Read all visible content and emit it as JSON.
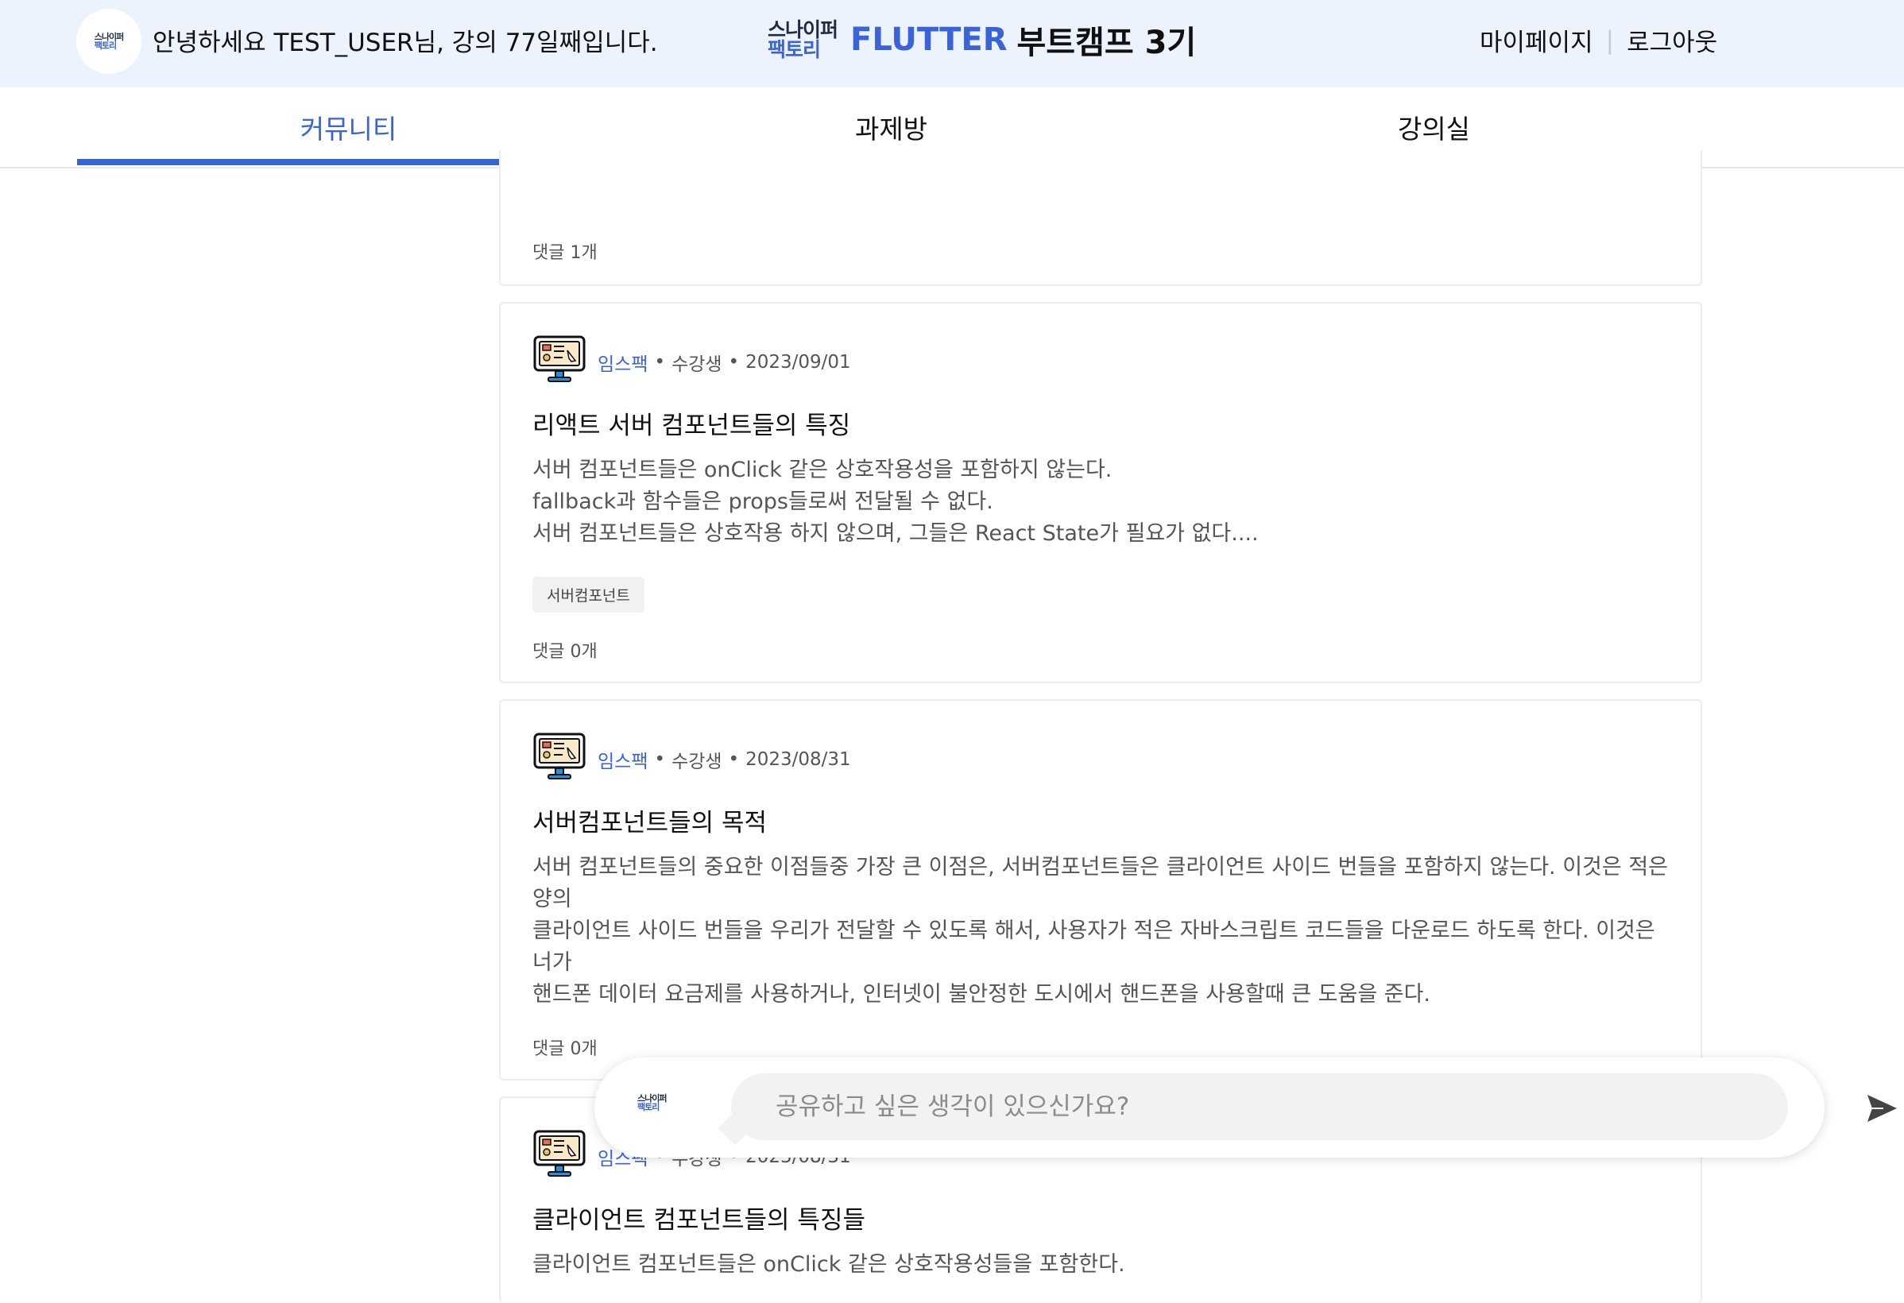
{
  "header": {
    "logo_top": "스나이퍼",
    "logo_bottom": "팩토리",
    "greeting": "안녕하세요 TEST_USER님, 강의 77일째입니다.",
    "brand_flutter": "FLUTTER",
    "brand_rest": "부트캠프 3기",
    "mypage_label": "마이페이지",
    "logout_label": "로그아웃",
    "separator": "|"
  },
  "tabs": [
    {
      "label": "커뮤니티",
      "active": true
    },
    {
      "label": "과제방",
      "active": false
    },
    {
      "label": "강의실",
      "active": false
    }
  ],
  "posts": [
    {
      "comments": "댓글 1개"
    },
    {
      "author": "임스팩",
      "role": "수강생",
      "date": "2023/09/01",
      "title": "리액트 서버 컴포넌트들의 특징",
      "body": [
        "서버 컴포넌트들은 onClick 같은 상호작용성을 포함하지 않는다.",
        "fallback과 함수들은 props들로써 전달될 수 없다.",
        "서버 컴포넌트들은 상호작용 하지 않으며, 그들은 React State가 필요가 없다...."
      ],
      "tag": "서버컴포넌트",
      "comments": "댓글 0개"
    },
    {
      "author": "임스팩",
      "role": "수강생",
      "date": "2023/08/31",
      "title": "서버컴포넌트들의 목적",
      "body": [
        "서버 컴포넌트들의 중요한 이점들중 가장 큰 이점은, 서버컴포넌트들은 클라이언트 사이드 번들을 포함하지 않는다. 이것은 적은 양의",
        "클라이언트 사이드 번들을 우리가 전달할 수 있도록 해서, 사용자가 적은 자바스크립트 코드들을 다운로드 하도록 한다. 이것은 너가",
        "핸드폰 데이터 요금제를 사용하거나, 인터넷이 불안정한 도시에서 핸드폰을 사용할때 큰 도움을 준다."
      ],
      "comments": "댓글 0개"
    },
    {
      "author": "임스팩",
      "role": "수강생",
      "date": "2023/08/31",
      "title": "클라이언트 컴포넌트들의 특징들",
      "body": [
        "클라이언트 컴포넌트들은 onClick 같은 상호작용성들을 포함한다."
      ]
    }
  ],
  "composer": {
    "placeholder": "공유하고 싶은 생각이 있으신가요?"
  },
  "icons": {
    "avatar": "monitor-icon",
    "send": "send-icon"
  },
  "colors": {
    "accent": "#3b63d8",
    "header_bg": "#edf3fc"
  }
}
